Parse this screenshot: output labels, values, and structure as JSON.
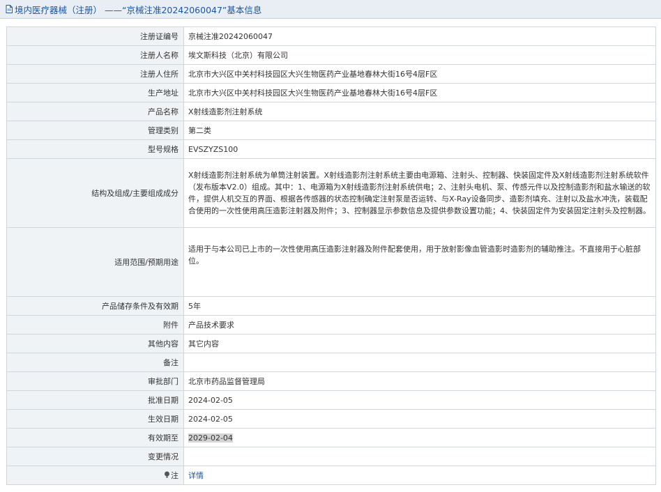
{
  "header": {
    "title": "境内医疗器械（注册） ——“京械注准20242060047”基本信息"
  },
  "rows": [
    {
      "label": "注册证编号",
      "value": "京械注准20242060047"
    },
    {
      "label": "注册人名称",
      "value": "埃文斯科技（北京）有限公司"
    },
    {
      "label": "注册人住所",
      "value": "北京市大兴区中关村科技园区大兴生物医药产业基地春林大街16号4层F区"
    },
    {
      "label": "生产地址",
      "value": "北京市大兴区中关村科技园区大兴生物医药产业基地春林大街16号4层F区"
    },
    {
      "label": "产品名称",
      "value": "X射线造影剂注射系统"
    },
    {
      "label": "管理类别",
      "value": "第二类"
    },
    {
      "label": "型号规格",
      "value": "EVSZYZS100"
    },
    {
      "label": "结构及组成/主要组成成分",
      "value": "X射线造影剂注射系统为单筒注射装置。X射线造影剂注射系统主要由电源箱、注射头、控制器、快装固定件及X射线造影剂注射系统软件（发布版本V2.0）组成。其中：1、电源箱为X射线造影剂注射系统供电；2、注射头电机、泵、传感元件以及控制造影剂和盐水输送的软件，提供人机交互的界面、根据各传感器的状态控制确定注射泵是否运转、与X-Ray设备同步、造影剂填充、注射以及盐水冲洗，装载配合使用的一次性使用高压造影注射器及附件；3、控制器显示参数信息及提供参数设置功能；4、快装固定件为安装固定注射头及控制器。"
    },
    {
      "label": "适用范围/预期用途",
      "value": "适用于与本公司已上市的一次性使用高压造影注射器及附件配套使用，用于放射影像血管造影时造影剂的辅助推注。不直接用于心脏部位。"
    },
    {
      "label": "产品储存条件及有效期",
      "value": "5年"
    },
    {
      "label": "附件",
      "value": "产品技术要求"
    },
    {
      "label": "其他内容",
      "value": "其它内容"
    },
    {
      "label": "备注",
      "value": ""
    },
    {
      "label": "审批部门",
      "value": "北京市药品监督管理局"
    },
    {
      "label": "批准日期",
      "value": "2024-02-05"
    },
    {
      "label": "生效日期",
      "value": "2024-02-05"
    },
    {
      "label": "有效期至",
      "value": "2029-02-04"
    },
    {
      "label": "变更情况",
      "value": ""
    }
  ],
  "note": {
    "label": "注",
    "link": "详情"
  },
  "icons": {
    "title": "document-icon",
    "note": "lightbulb-icon"
  },
  "colors": {
    "accent": "#1a56a6",
    "label_bg": "#f0f3f6",
    "title_bg": "#e9eef4"
  }
}
